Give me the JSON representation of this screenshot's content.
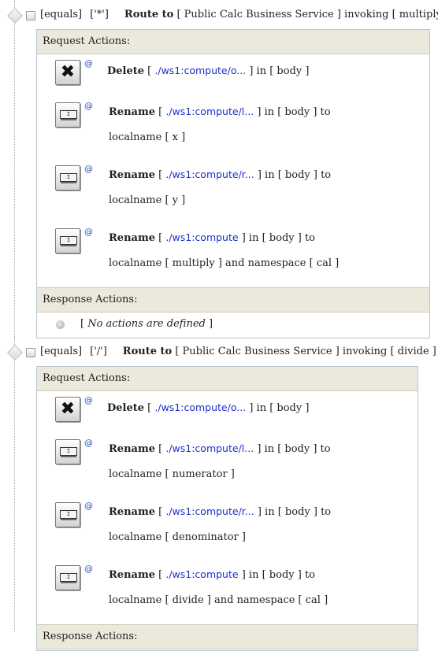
{
  "routes": [
    {
      "condition_op": "[equals]",
      "condition_val": "['*']",
      "route_kw": "Route to",
      "route_desc": "[ Public Calc Business Service ] invoking [ multiply ]",
      "request_header": "Request Actions:",
      "response_header": "Response Actions:",
      "actions": [
        {
          "verb": "Delete",
          "pre": "[",
          "path": "./ws1:compute/o...",
          "post": "] in [ body ]",
          "line2": ""
        },
        {
          "verb": "Rename",
          "pre": "[",
          "path": "./ws1:compute/l...",
          "post": "] in [ body ] to",
          "line2": "localname [ x ]"
        },
        {
          "verb": "Rename",
          "pre": "[",
          "path": "./ws1:compute/r...",
          "post": "] in [ body ] to",
          "line2": "localname [ y ]"
        },
        {
          "verb": "Rename",
          "pre": "[",
          "path": "./ws1:compute",
          "post": "] in [ body ] to",
          "line2": "localname [ multiply ] and namespace [ cal ]"
        }
      ],
      "no_actions_pre": "[",
      "no_actions_text": "No actions are defined",
      "no_actions_post": "]"
    },
    {
      "condition_op": "[equals]",
      "condition_val": "['/']",
      "route_kw": "Route to",
      "route_desc": "[ Public Calc Business Service ] invoking [ divide ]",
      "request_header": "Request Actions:",
      "response_header": "Response Actions:",
      "actions": [
        {
          "verb": "Delete",
          "pre": "[",
          "path": "./ws1:compute/o...",
          "post": "] in [ body ]",
          "line2": ""
        },
        {
          "verb": "Rename",
          "pre": "[",
          "path": "./ws1:compute/l...",
          "post": "] in [ body ] to",
          "line2": "localname [ numerator ]"
        },
        {
          "verb": "Rename",
          "pre": "[",
          "path": "./ws1:compute/r...",
          "post": "] in [ body ] to",
          "line2": "localname [ denominator ]"
        },
        {
          "verb": "Rename",
          "pre": "[",
          "path": "./ws1:compute",
          "post": "] in [ body ] to",
          "line2": "localname [ divide ] and namespace [ cal ]"
        }
      ]
    }
  ],
  "icons": {
    "delete": "delete-x-icon",
    "rename": "rename-field-icon",
    "at": "@"
  }
}
